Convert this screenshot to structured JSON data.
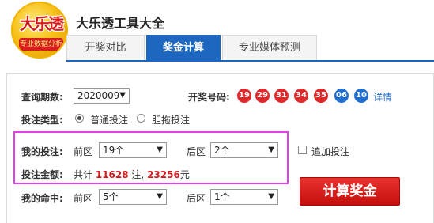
{
  "app": {
    "title": "大乐透工具大全"
  },
  "logo": {
    "text": "大乐透",
    "sub": "专业数据分析"
  },
  "tabs": [
    {
      "label": "开奖对比"
    },
    {
      "label": "奖金计算"
    },
    {
      "label": "专业媒体预测"
    }
  ],
  "query": {
    "label": "查询期数:",
    "value": "2020009",
    "draw_label": "开奖号码:",
    "front_balls": [
      "19",
      "29",
      "31",
      "34",
      "35"
    ],
    "back_balls": [
      "06",
      "10"
    ],
    "detail_link": "详情"
  },
  "bet_type": {
    "label": "投注类型:",
    "options": [
      "普通投注",
      "胆拖投注"
    ],
    "selected": "普通投注"
  },
  "my_bet": {
    "label": "我的投注:",
    "front_label": "前区",
    "front_value": "19个",
    "back_label": "后区",
    "back_value": "2个",
    "extra_label": "追加投注"
  },
  "amount": {
    "label": "投注金额:",
    "prefix": "共计",
    "notes": "11628",
    "notes_unit": "注,",
    "money": "23256",
    "money_unit": "元"
  },
  "my_hit": {
    "label": "我的命中:",
    "front_label": "前区",
    "front_value": "5个",
    "back_label": "后区",
    "back_value": "1个"
  },
  "calc_button": {
    "label": "计算奖金"
  },
  "colors": {
    "accent": "#1e67c0",
    "ball_red": "#e0282a",
    "ball_blue": "#1e6fd0",
    "highlight": "#e040e8",
    "button": "#d6171a"
  }
}
